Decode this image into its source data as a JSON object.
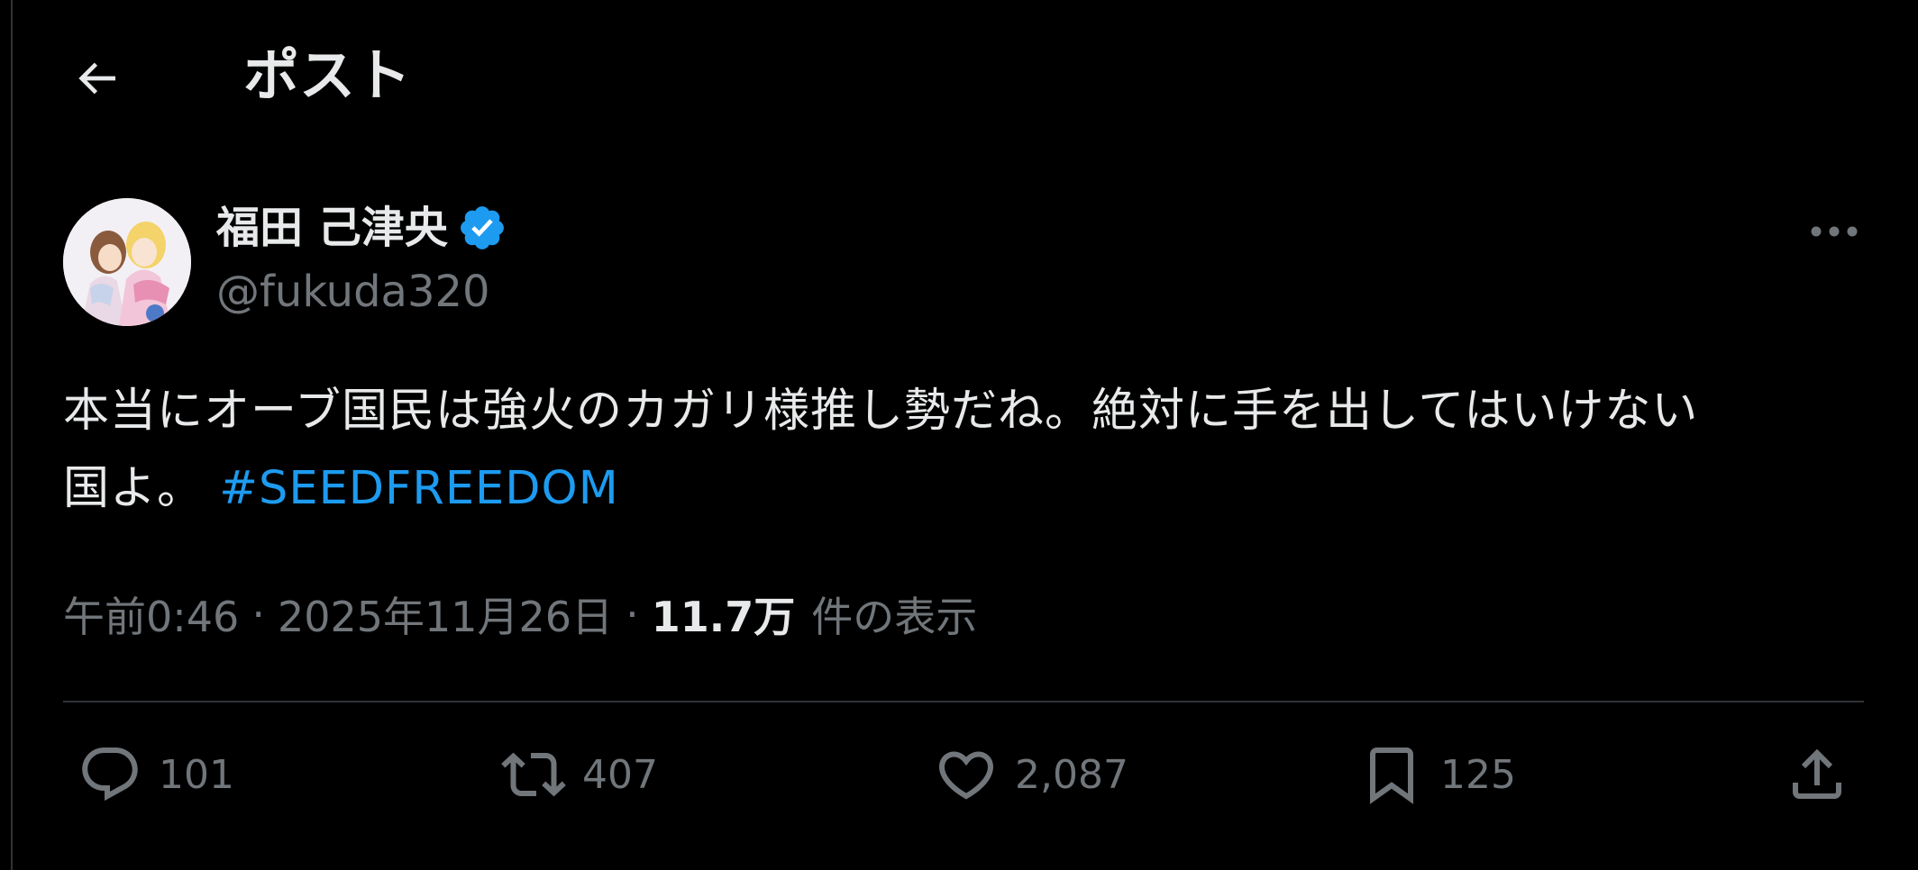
{
  "header": {
    "back_icon": "arrow-left-icon",
    "title": "ポスト"
  },
  "author": {
    "name": "福田 己津央",
    "handle": "@fukuda320",
    "verified_icon": "verified-badge-icon",
    "more_icon": "more-horizontal-icon"
  },
  "post": {
    "text_line1": "本当にオーブ国民は強火のカガリ様推し勢だね。絶対に手を出してはいけない",
    "text_line2": "国よ。",
    "hashtag": "#SEEDFREEDOM"
  },
  "meta": {
    "time": "午前0:46",
    "separator1": "·",
    "date": "2025年11月26日",
    "separator2": "·",
    "views_count": "11.7万",
    "views_label": "件の表示"
  },
  "actions": {
    "reply": {
      "icon": "reply-icon",
      "count": "101"
    },
    "repost": {
      "icon": "repost-icon",
      "count": "407"
    },
    "like": {
      "icon": "heart-icon",
      "count": "2,087"
    },
    "bookmark": {
      "icon": "bookmark-icon",
      "count": "125"
    },
    "share": {
      "icon": "share-icon"
    }
  },
  "colors": {
    "background": "#000000",
    "text_primary": "#e7e9ea",
    "text_secondary": "#71767b",
    "accent": "#1d9bf0",
    "divider": "#2f3336"
  }
}
